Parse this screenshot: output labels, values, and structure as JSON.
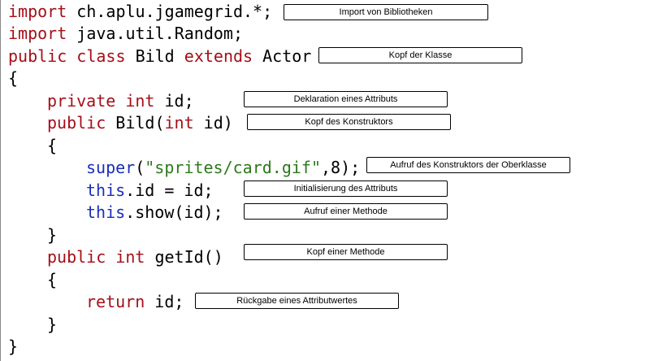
{
  "code": {
    "line1": {
      "kw": "import",
      "rest": " ch.aplu.jgamegrid.*;"
    },
    "line2": {
      "kw": "import",
      "rest": " java.util.Random;"
    },
    "line3": {
      "kw1": "public",
      "kw2": "class",
      "name": "Bild",
      "kw3": "extends",
      "parent": "Actor"
    },
    "line4": {
      "text": "{"
    },
    "line5": {
      "kw1": "private",
      "kw2": "int",
      "rest": " id;"
    },
    "line6": {
      "kw1": "public",
      "name": " Bild(",
      "kw2": "int",
      "rest": " id)"
    },
    "line7": {
      "text": "{"
    },
    "line8": {
      "kw": "super",
      "p1": "(",
      "str": "\"sprites/card.gif\"",
      "rest": ",8);"
    },
    "line9": {
      "kw": "this",
      "rest": ".id = id;"
    },
    "line10": {
      "kw": "this",
      "rest": ".show(id);"
    },
    "line11": {
      "text": "}"
    },
    "line12": {
      "kw1": "public",
      "kw2": "int",
      "rest": " getId()"
    },
    "line13": {
      "text": "{"
    },
    "line14": {
      "kw": "return",
      "rest": " id;"
    },
    "line15": {
      "text": "}"
    },
    "line16": {
      "text": "}"
    }
  },
  "labels": {
    "imports": "Import von Bibliotheken",
    "class_head": "Kopf der Klasse",
    "attribute_decl": "Deklaration eines Attributs",
    "constructor_head": "Kopf des Konstruktors",
    "super_call": "Aufruf des Konstruktors der Oberklasse",
    "attribute_init": "Initialisierung des Attributs",
    "method_call": "Aufruf einer Methode",
    "method_head": "Kopf einer Methode",
    "return_value": "Rückgabe eines Attributwertes"
  },
  "colors": {
    "keyword": "#a50f18",
    "blue_keyword": "#1a2eb8",
    "string": "#2a7a18"
  }
}
